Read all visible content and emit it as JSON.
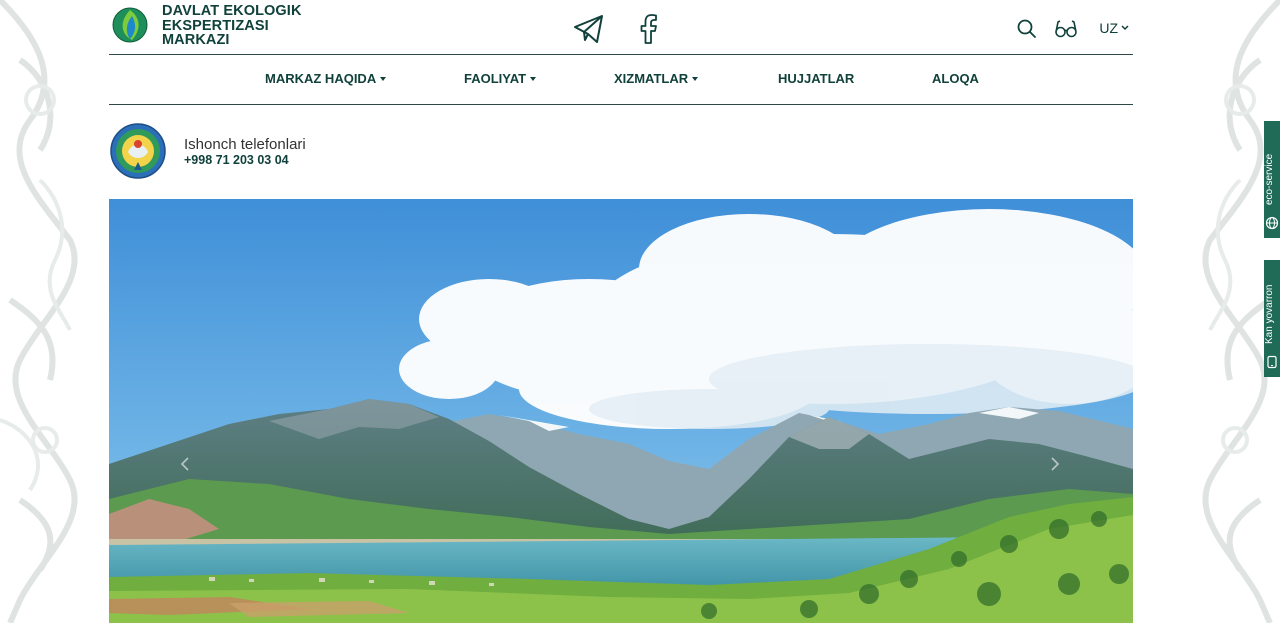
{
  "brand": {
    "line1": "DAVLAT EKOLOGIK",
    "line2": "EKSPERTIZASI",
    "line3": "MARKAZI"
  },
  "header": {
    "social_icons": [
      "telegram-icon",
      "facebook-icon"
    ],
    "tools_icons": [
      "search-icon",
      "glasses-icon"
    ],
    "language": "UZ"
  },
  "nav": {
    "items": [
      {
        "label": "MARKAZ HAQIDA",
        "dropdown": true
      },
      {
        "label": "FAOLIYAT",
        "dropdown": true
      },
      {
        "label": "XIZMATLAR",
        "dropdown": true
      },
      {
        "label": "HUJJATLAR",
        "dropdown": false
      },
      {
        "label": "ALOQA",
        "dropdown": false
      }
    ]
  },
  "hotline": {
    "title": "Ishonch telefonlari",
    "phone": "+998 71 203 03 04"
  },
  "side_tabs": [
    {
      "label": "eco-service",
      "icon": "globe-icon"
    },
    {
      "label": "Kan yovarron",
      "icon": "phone-icon"
    }
  ],
  "colors": {
    "brand_dark": "#10413b",
    "accent_green": "#1f6b57",
    "divider": "#2f4a46"
  }
}
